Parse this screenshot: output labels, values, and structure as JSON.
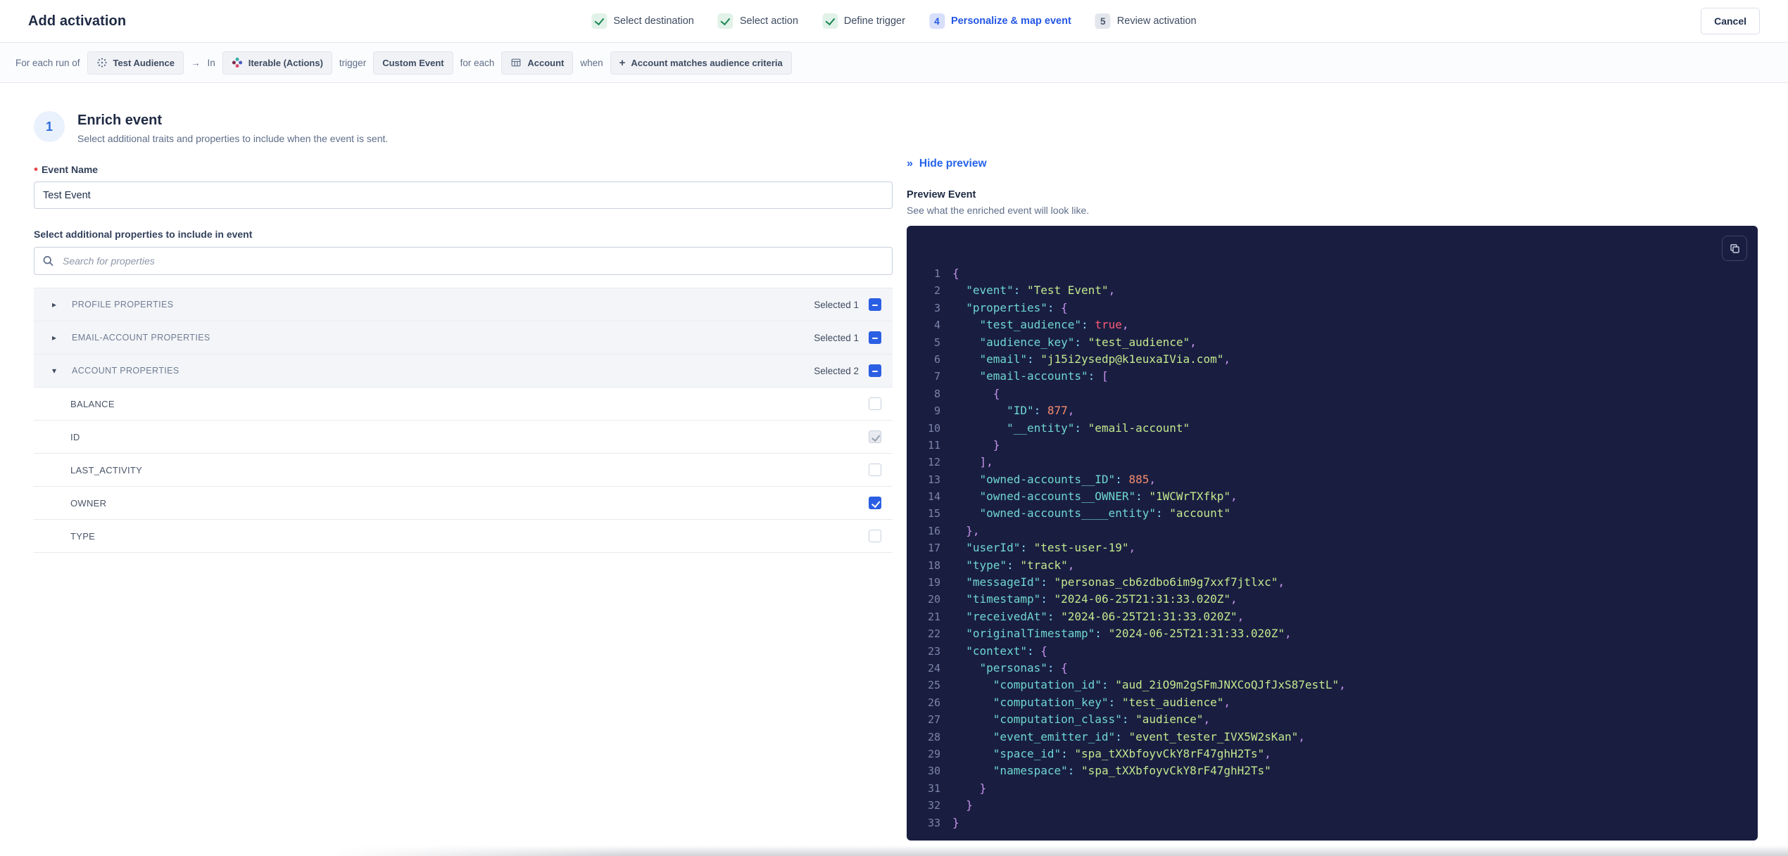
{
  "header": {
    "title": "Add activation",
    "cancel_label": "Cancel",
    "steps": [
      {
        "label": "Select destination",
        "status": "done"
      },
      {
        "label": "Select action",
        "status": "done"
      },
      {
        "label": "Define trigger",
        "status": "done"
      },
      {
        "label": "Personalize & map event",
        "status": "active",
        "number": "4"
      },
      {
        "label": "Review activation",
        "status": "todo",
        "number": "5"
      }
    ]
  },
  "context_bar": {
    "prefix": "For each run of",
    "audience_chip": {
      "icon": "audience-icon",
      "label": "Test Audience"
    },
    "arrow": "→",
    "in_label": "In",
    "destination_chip": {
      "icon": "iterable-icon",
      "label": "Iterable (Actions)"
    },
    "trigger_label": "trigger",
    "event_chip": {
      "label": "Custom Event"
    },
    "for_each_label": "for each",
    "entity_chip": {
      "icon": "table-icon",
      "label": "Account"
    },
    "when_label": "when",
    "condition_chip": {
      "icon": "plus-icon",
      "label": "Account matches audience criteria"
    }
  },
  "enrich": {
    "step_number": "1",
    "title": "Enrich event",
    "subtitle": "Select additional traits and properties to include when the event is sent.",
    "required_marker": "•",
    "event_name_label": "Event Name",
    "event_name_value": "Test Event",
    "properties_label": "Select additional properties to include in event",
    "search_placeholder": "Search for properties",
    "groups": [
      {
        "label": "PROFILE PROPERTIES",
        "selected_text": "Selected 1",
        "expanded": false
      },
      {
        "label": "EMAIL-ACCOUNT PROPERTIES",
        "selected_text": "Selected 1",
        "expanded": false
      },
      {
        "label": "ACCOUNT PROPERTIES",
        "selected_text": "Selected 2",
        "expanded": true,
        "items": [
          {
            "label": "BALANCE",
            "state": "unchecked"
          },
          {
            "label": "ID",
            "state": "checked-disabled"
          },
          {
            "label": "LAST_ACTIVITY",
            "state": "unchecked"
          },
          {
            "label": "OWNER",
            "state": "checked"
          },
          {
            "label": "TYPE",
            "state": "unchecked"
          }
        ]
      }
    ]
  },
  "preview": {
    "chevrons": "»",
    "hide_label": "Hide preview",
    "title": "Preview Event",
    "subtitle": "See what the enriched event will look like.",
    "copy_icon": "copy-icon",
    "code_colors": {
      "bg": "#191E41",
      "line_number": "#7B84A9",
      "key": "#6FD6D0",
      "string": "#C3E88D",
      "number": "#F78C6C",
      "boolean": "#FF5874",
      "punct": "#C792EA",
      "colon": "#89DDFF"
    },
    "code_lines": [
      "{",
      "  \"event\": \"Test Event\",",
      "  \"properties\": {",
      "    \"test_audience\": true,",
      "    \"audience_key\": \"test_audience\",",
      "    \"email\": \"j15i2ysedp@k1euxaIVia.com\",",
      "    \"email-accounts\": [",
      "      {",
      "        \"ID\": 877,",
      "        \"__entity\": \"email-account\"",
      "      }",
      "    ],",
      "    \"owned-accounts__ID\": 885,",
      "    \"owned-accounts__OWNER\": \"1WCWrTXfkp\",",
      "    \"owned-accounts____entity\": \"account\"",
      "  },",
      "  \"userId\": \"test-user-19\",",
      "  \"type\": \"track\",",
      "  \"messageId\": \"personas_cb6zdbo6im9g7xxf7jtlxc\",",
      "  \"timestamp\": \"2024-06-25T21:31:33.020Z\",",
      "  \"receivedAt\": \"2024-06-25T21:31:33.020Z\",",
      "  \"originalTimestamp\": \"2024-06-25T21:31:33.020Z\",",
      "  \"context\": {",
      "    \"personas\": {",
      "      \"computation_id\": \"aud_2iO9m2gSFmJNXCoQJfJxS87estL\",",
      "      \"computation_key\": \"test_audience\",",
      "      \"computation_class\": \"audience\",",
      "      \"event_emitter_id\": \"event_tester_IVX5W2sKan\",",
      "      \"space_id\": \"spa_tXXbfoyvCkY8rF47ghH2Ts\",",
      "      \"namespace\": \"spa_tXXbfoyvCkY8rF47ghH2Ts\"",
      "    }",
      "  }",
      "}"
    ]
  },
  "colors": {
    "accent_blue": "#2457E5",
    "checkbox_blue": "#2B5FE3",
    "success_green": "#188650",
    "required_red": "#E5484D"
  }
}
